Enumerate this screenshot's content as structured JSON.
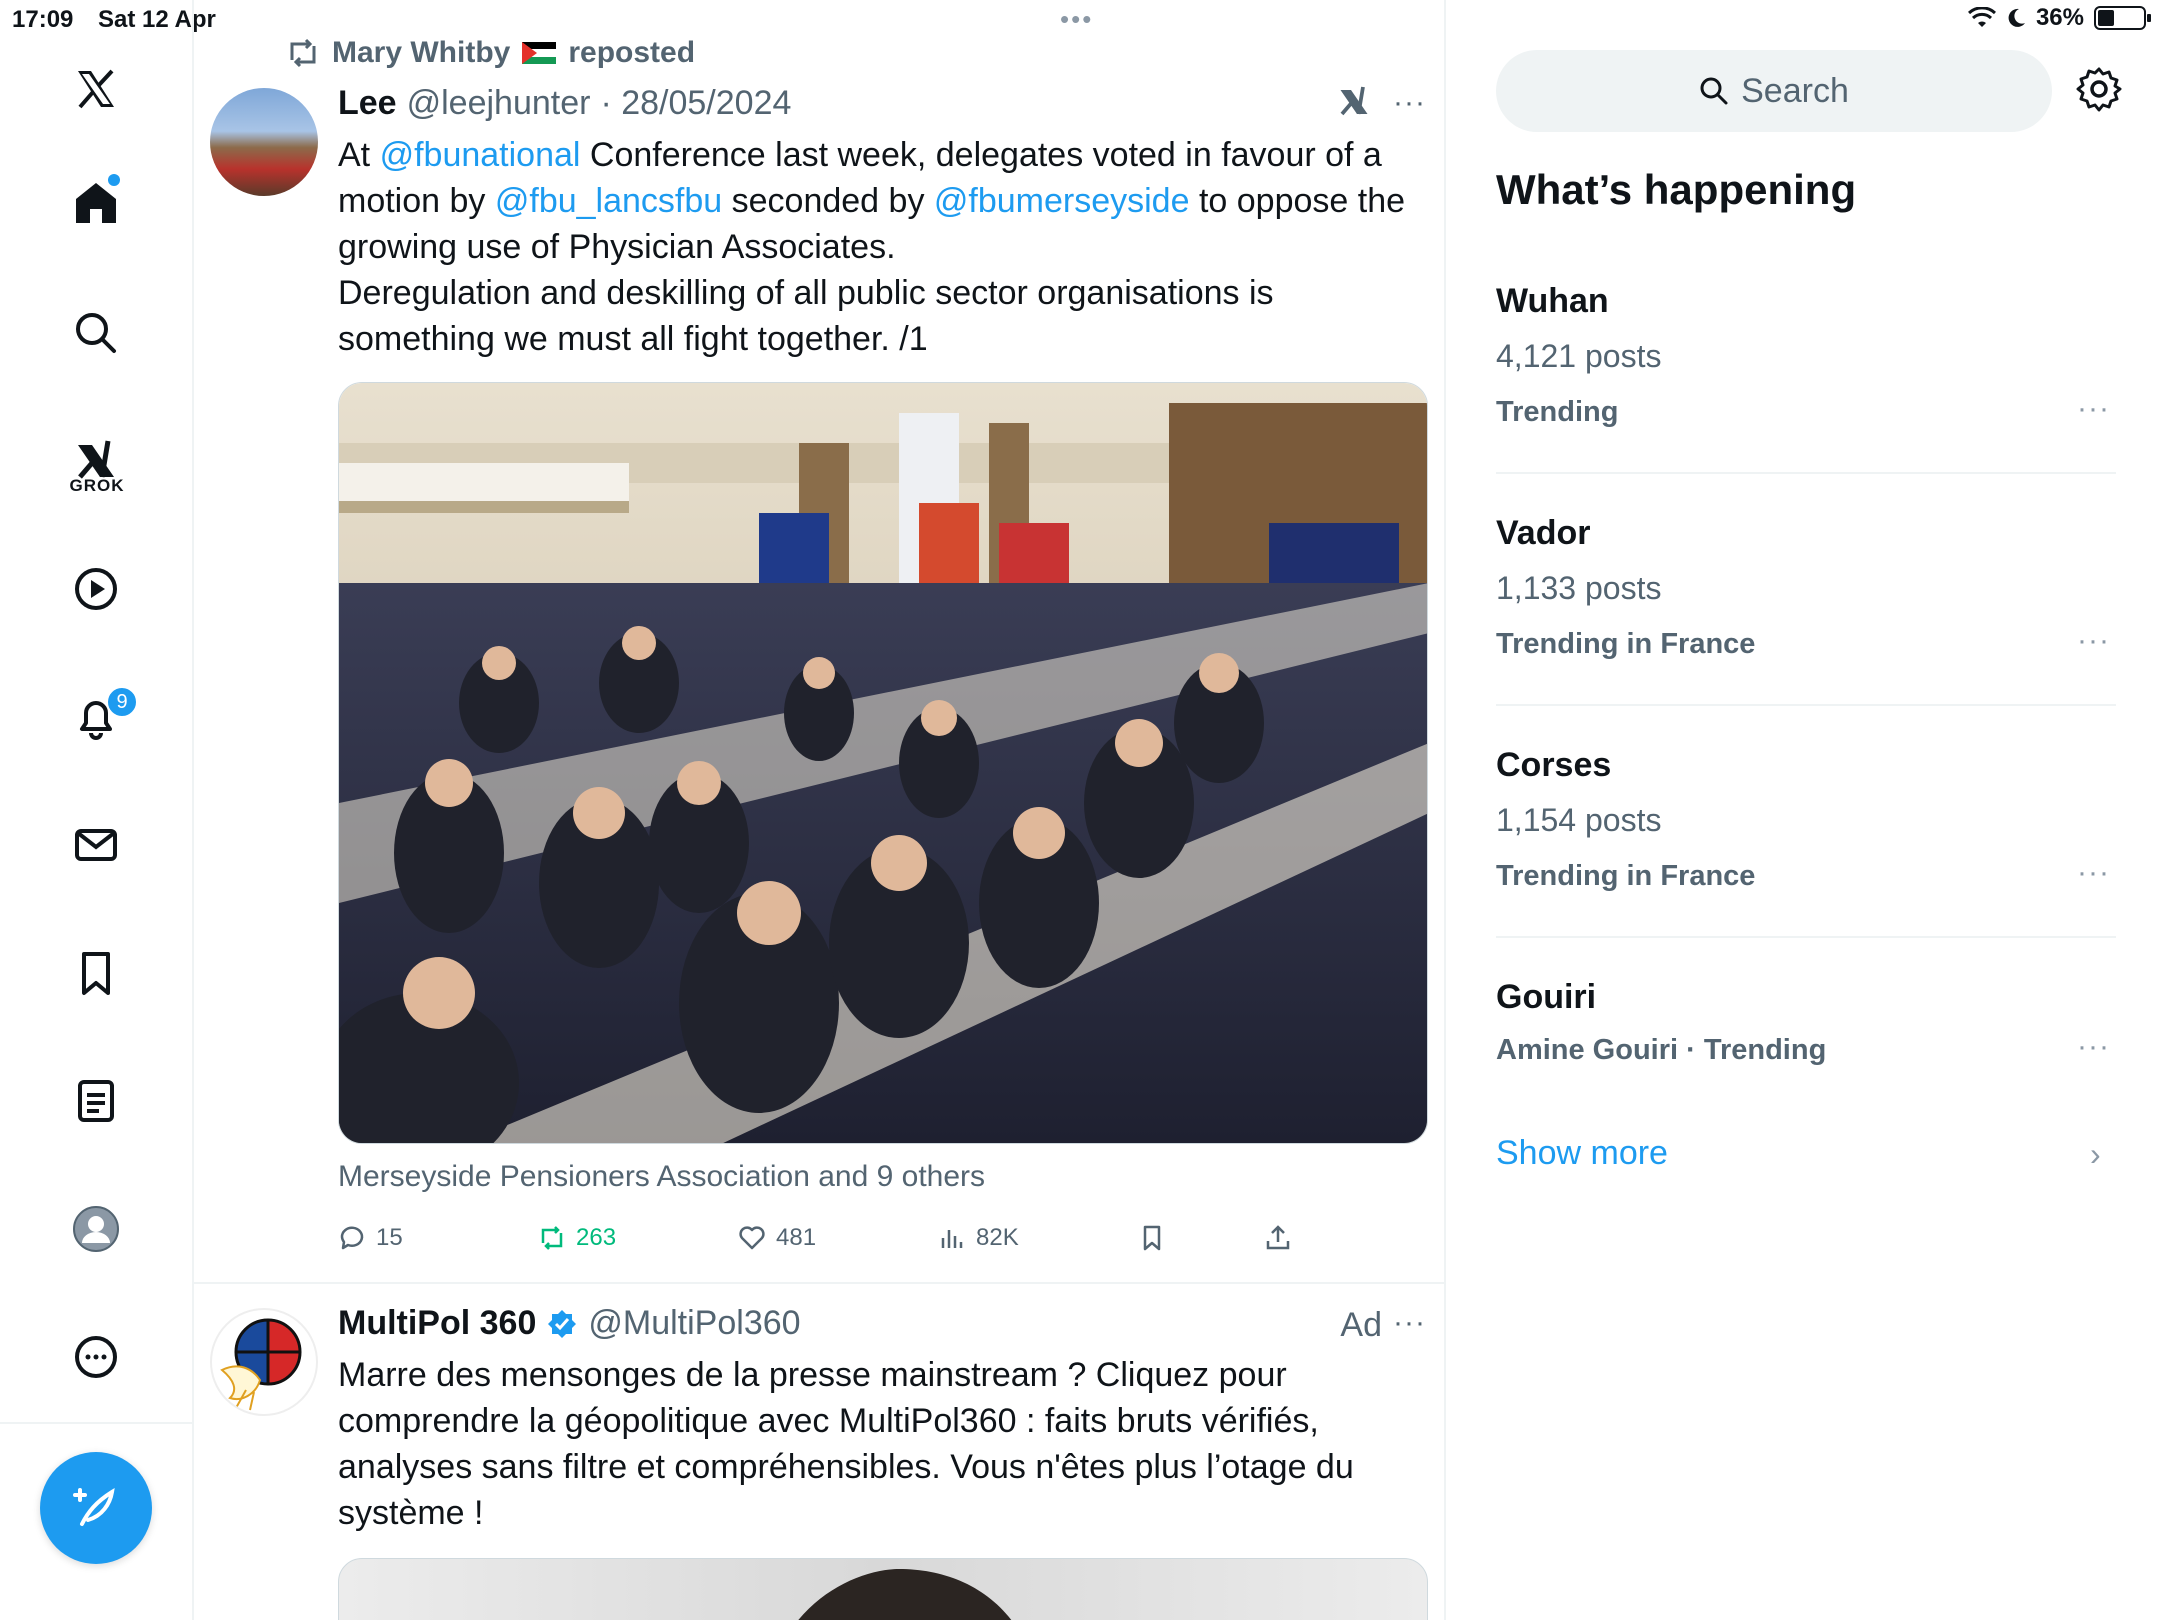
{
  "status_bar": {
    "time": "17:09",
    "date": "Sat 12 Apr",
    "battery": "36%"
  },
  "sidebar": {
    "grok_label": "GROK",
    "notifications_badge": "9",
    "items": [
      {
        "icon": "x-logo-icon"
      },
      {
        "icon": "home-icon"
      },
      {
        "icon": "search-icon"
      },
      {
        "icon": "grok-icon"
      },
      {
        "icon": "video-icon"
      },
      {
        "icon": "bell-icon"
      },
      {
        "icon": "mail-icon"
      },
      {
        "icon": "bookmark-icon"
      },
      {
        "icon": "lists-icon"
      },
      {
        "icon": "profile-icon"
      },
      {
        "icon": "more-icon"
      }
    ],
    "compose_icon": "compose-icon"
  },
  "tweet1": {
    "repost_by": "Mary Whitby",
    "repost_suffix": "reposted",
    "name": "Lee",
    "handle": "@leejhunter",
    "date": "· 28/05/2024",
    "text": {
      "p1": "At ",
      "m1": "@fbunational",
      "p2": " Conference last week, delegates voted in favour of a motion by ",
      "m2": "@fbu_lancsfbu",
      "p3": " seconded by ",
      "m3": "@fbumerseyside",
      "p4": " to oppose the growing use of Physician Associates.",
      "p5": "Deregulation and deskilling of all public sector organisations is something we must all fight together.  /1"
    },
    "caption": "Merseyside Pensioners Association and 9 others",
    "actions": {
      "replies": "15",
      "reposts": "263",
      "likes": "481",
      "views": "82K"
    },
    "more": "···"
  },
  "tweet2": {
    "name": "MultiPol 360",
    "handle": "@MultiPol360",
    "ad_label": "Ad",
    "text": "Marre des mensonges de la presse mainstream ?  Cliquez pour comprendre la géopolitique avec MultiPol360 : faits bruts vérifiés, analyses sans filtre et compréhensibles. Vous n'êtes plus l’otage du système !",
    "more": "···"
  },
  "right": {
    "search_placeholder": "Search",
    "section_title": "What’s happening",
    "trends": [
      {
        "name": "Wuhan",
        "posts": "4,121 posts",
        "context": "Trending"
      },
      {
        "name": "Vador",
        "posts": "1,133 posts",
        "context": "Trending in France"
      },
      {
        "name": "Corses",
        "posts": "1,154 posts",
        "context": "Trending in France"
      },
      {
        "name": "Gouiri",
        "posts": "",
        "context": "Amine Gouiri · Trending"
      }
    ],
    "more": "···",
    "show_more": "Show more",
    "show_more_chevron": "›"
  },
  "colors": {
    "accent": "#1d9bf0",
    "retweet_green": "#00ba7c",
    "secondary_text": "#536471"
  }
}
